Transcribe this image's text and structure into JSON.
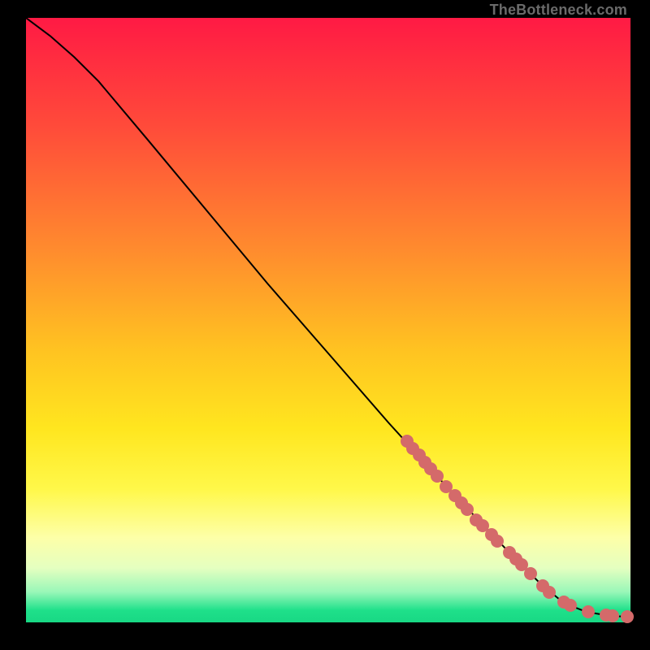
{
  "attribution": "TheBottleneck.com",
  "colors": {
    "page_bg": "#000000",
    "dot": "#d46a6a",
    "curve": "#000000",
    "gradient_top": "#ff1a44",
    "gradient_bottom": "#18d884"
  },
  "chart_data": {
    "type": "line",
    "title": "",
    "xlabel": "",
    "ylabel": "",
    "xlim": [
      0,
      100
    ],
    "ylim": [
      0,
      100
    ],
    "grid": false,
    "legend": false,
    "series": [
      {
        "name": "curve",
        "x": [
          0,
          4,
          8,
          12,
          20,
          30,
          40,
          50,
          60,
          70,
          80,
          85,
          88,
          90,
          92,
          94,
          96,
          98,
          100
        ],
        "y": [
          100,
          97,
          93.5,
          89.5,
          80,
          68,
          56,
          44.5,
          33,
          22,
          11.5,
          6.5,
          4,
          2.8,
          2,
          1.5,
          1.2,
          1,
          1
        ]
      }
    ],
    "markers": [
      {
        "x": 63,
        "y": 30
      },
      {
        "x": 64,
        "y": 28.8
      },
      {
        "x": 65,
        "y": 27.7
      },
      {
        "x": 66,
        "y": 26.5
      },
      {
        "x": 67,
        "y": 25.4
      },
      {
        "x": 68,
        "y": 24.2
      },
      {
        "x": 69.5,
        "y": 22.5
      },
      {
        "x": 71,
        "y": 21
      },
      {
        "x": 72,
        "y": 19.8
      },
      {
        "x": 73,
        "y": 18.7
      },
      {
        "x": 74.5,
        "y": 17
      },
      {
        "x": 75.5,
        "y": 16
      },
      {
        "x": 77,
        "y": 14.5
      },
      {
        "x": 78,
        "y": 13.5
      },
      {
        "x": 80,
        "y": 11.5
      },
      {
        "x": 81,
        "y": 10.5
      },
      {
        "x": 82,
        "y": 9.5
      },
      {
        "x": 83.5,
        "y": 8
      },
      {
        "x": 85.5,
        "y": 6
      },
      {
        "x": 86.5,
        "y": 5
      },
      {
        "x": 89,
        "y": 3.3
      },
      {
        "x": 90,
        "y": 2.8
      },
      {
        "x": 93,
        "y": 1.7
      },
      {
        "x": 96,
        "y": 1.2
      },
      {
        "x": 97,
        "y": 1.1
      },
      {
        "x": 99.5,
        "y": 1
      }
    ]
  }
}
